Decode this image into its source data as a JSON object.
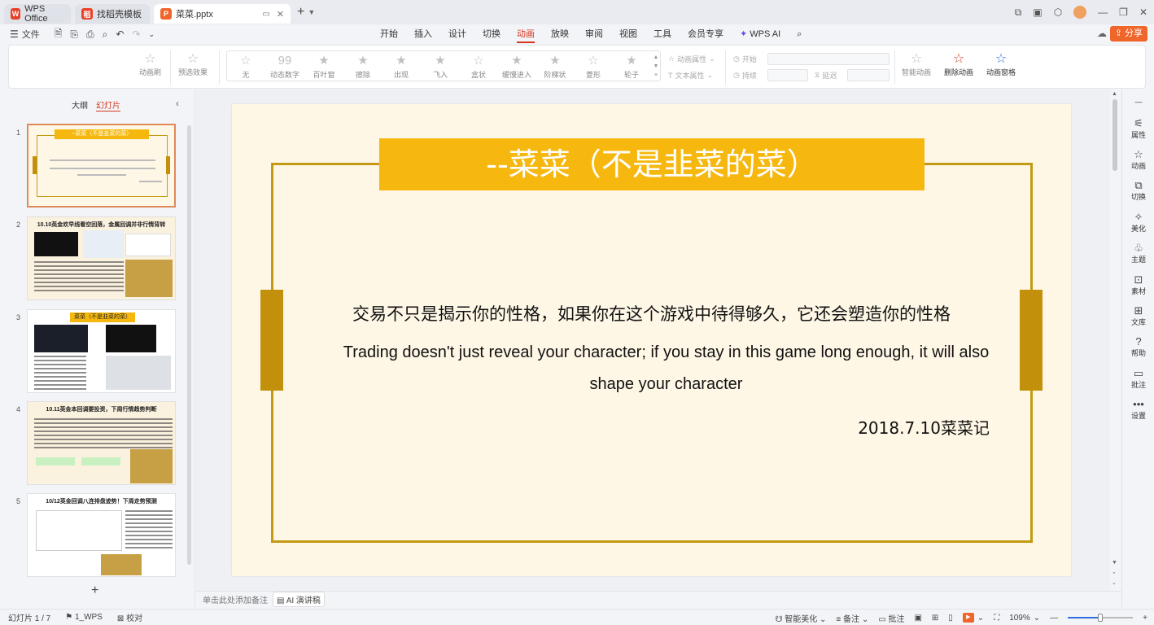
{
  "titlebar": {
    "tabs": [
      {
        "label": "WPS Office",
        "icon": "wps-logo-icon",
        "color": "#e8412a"
      },
      {
        "label": "找稻壳模板",
        "icon": "docer-logo-icon",
        "color": "#e8412a"
      },
      {
        "label": "菜菜.pptx",
        "icon": "ppt-file-icon",
        "color": "#f0652a"
      }
    ]
  },
  "menubar": {
    "file_label": "文件",
    "tabs": [
      "开始",
      "插入",
      "设计",
      "切换",
      "动画",
      "放映",
      "审阅",
      "视图",
      "工具",
      "会员专享",
      "WPS AI"
    ],
    "active_tab": "动画",
    "share_label": "分享"
  },
  "ribbon": {
    "anim_brush": "动画刷",
    "preview": "预选效果",
    "gallery": [
      "无",
      "动态数字",
      "百叶窗",
      "擦除",
      "出现",
      "飞入",
      "盒状",
      "缓慢进入",
      "阶梯状",
      "菱形",
      "轮子"
    ],
    "anim_props": "动画属性",
    "text_props": "文本属性",
    "start_label": "开始",
    "duration_label": "持续",
    "delay_label": "延迟",
    "smart_anim": "智能动画",
    "delete_anim": "删除动画",
    "anim_pane": "动画窗格"
  },
  "leftpanel": {
    "tab_outline": "大纲",
    "tab_slides": "幻灯片",
    "thumbs": [
      {
        "num": "1",
        "title": "--菜菜（不是韭菜的菜）"
      },
      {
        "num": "2",
        "title": "10.10英金欢早线看空回落，金属回调并非行情背转"
      },
      {
        "num": "3",
        "title": "菜菜（不是韭菜的菜）"
      },
      {
        "num": "4",
        "title": "10.11英金本回调要投资，下周行情趋势判断"
      },
      {
        "num": "5",
        "title": "10/12英金回调八连排盘迹势！下周走势预测"
      }
    ]
  },
  "slide": {
    "title": "--菜菜（不是韭菜的菜）",
    "quote_cn": "交易不只是揭示你的性格，如果你在这个游戏中待得够久，它还会塑造你的性格",
    "quote_en": "Trading doesn't just reveal your character; if you stay in this game long enough, it will also shape your character",
    "signature": "2018.7.10菜菜记",
    "colors": {
      "banner": "#f6b80f",
      "frame": "#c49a14",
      "bar": "#c2900a",
      "bg": "#fef7e6"
    }
  },
  "rightbar": [
    "属性",
    "动画",
    "切换",
    "美化",
    "主题",
    "素材",
    "文库",
    "帮助",
    "批注",
    "设置"
  ],
  "notes": {
    "placeholder": "单击此处添加备注",
    "ai_label": "AI 演讲稿"
  },
  "status": {
    "slide_count": "幻灯片 1 / 7",
    "theme": "1_WPS",
    "proof": "校对",
    "smart_beautify": "智能美化",
    "notes": "备注",
    "comments": "批注",
    "zoom": "109%",
    "zoom_fraction": 0.5
  }
}
